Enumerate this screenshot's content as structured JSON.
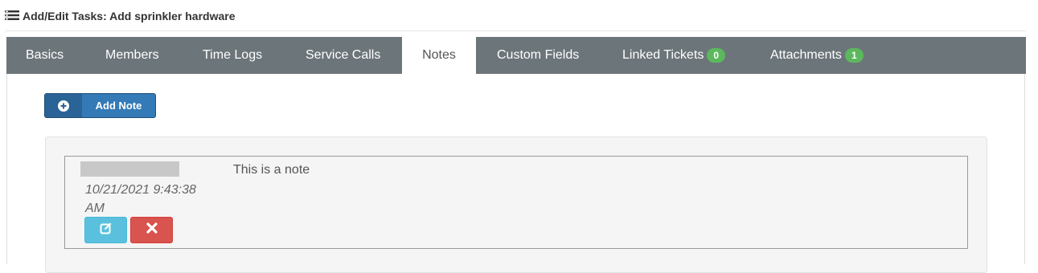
{
  "header": {
    "title": "Add/Edit Tasks: Add sprinkler hardware",
    "icon": "tasks-icon"
  },
  "tabs": [
    {
      "label": "Basics",
      "active": false
    },
    {
      "label": "Members",
      "active": false
    },
    {
      "label": "Time Logs",
      "active": false
    },
    {
      "label": "Service Calls",
      "active": false
    },
    {
      "label": "Notes",
      "active": true
    },
    {
      "label": "Custom Fields",
      "active": false
    },
    {
      "label": "Linked Tickets",
      "active": false,
      "badge": "0"
    },
    {
      "label": "Attachments",
      "active": false,
      "badge": "1"
    }
  ],
  "toolbar": {
    "add_note_label": "Add Note",
    "add_note_icon": "plus-circle-icon"
  },
  "notes": [
    {
      "date": "10/21/2021 9:43:38 AM",
      "text": "This is a note",
      "edit_icon": "edit-icon",
      "delete_icon": "close-icon"
    }
  ],
  "colors": {
    "tabbar": "#6c757a",
    "badge": "#5cb85c",
    "primary": "#337ab7",
    "info": "#5bc0de",
    "danger": "#d9534f"
  }
}
